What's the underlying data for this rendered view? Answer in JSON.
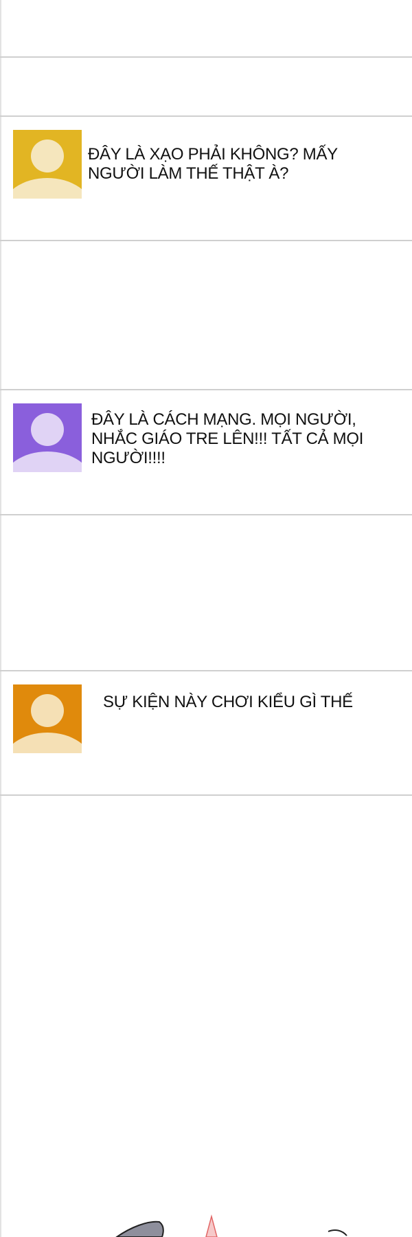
{
  "comments": [
    {
      "avatar_color": "#e2b523",
      "avatar_skin": "#f5e6bd",
      "text": "ĐÂY LÀ XẠO PHẢI KHÔNG? MẤY NGƯỜI LÀM THẾ THẬT À?"
    },
    {
      "avatar_color": "#8a5fdc",
      "avatar_skin": "#e0d3f5",
      "text": "ĐÂY LÀ CÁCH MẠNG. MỌI NGƯỜI, NHẮC GIÁO TRE LÊN!!! TẤT CẢ MỌI NGƯỜI!!!!"
    },
    {
      "avatar_color": "#e08a0c",
      "avatar_skin": "#f5e0b5",
      "text": "SỰ KIỆN NÀY CHƠI KIỂU GÌ THẾ"
    }
  ],
  "colors": {
    "background": "#ffffff",
    "divider": "#cfcfcf",
    "text": "#111111"
  }
}
